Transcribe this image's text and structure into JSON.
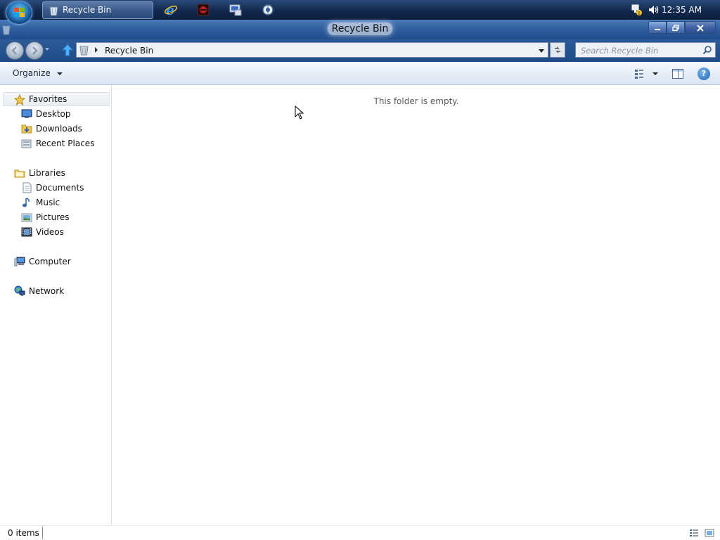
{
  "taskbar": {
    "active_task": "Recycle Bin",
    "clock": "12:35 AM",
    "pinned": [
      {
        "name": "internet-explorer-icon"
      },
      {
        "name": "media-app-icon"
      },
      {
        "name": "remote-desktop-icon"
      },
      {
        "name": "globe-app-icon"
      }
    ]
  },
  "window": {
    "title": "Recycle Bin",
    "address_path": "Recycle Bin",
    "search_placeholder": "Search Recycle Bin"
  },
  "toolbar": {
    "organize_label": "Organize"
  },
  "nav": {
    "favorites": {
      "label": "Favorites",
      "items": [
        {
          "label": "Desktop"
        },
        {
          "label": "Downloads"
        },
        {
          "label": "Recent Places"
        }
      ]
    },
    "libraries": {
      "label": "Libraries",
      "items": [
        {
          "label": "Documents"
        },
        {
          "label": "Music"
        },
        {
          "label": "Pictures"
        },
        {
          "label": "Videos"
        }
      ]
    },
    "computer_label": "Computer",
    "network_label": "Network"
  },
  "content": {
    "empty_message": "This folder is empty."
  },
  "status": {
    "item_count": "0 items"
  },
  "colors": {
    "taskbar": "#13294f",
    "titlebar": "#2e5c9c",
    "command_bar": "#e6eef8"
  }
}
